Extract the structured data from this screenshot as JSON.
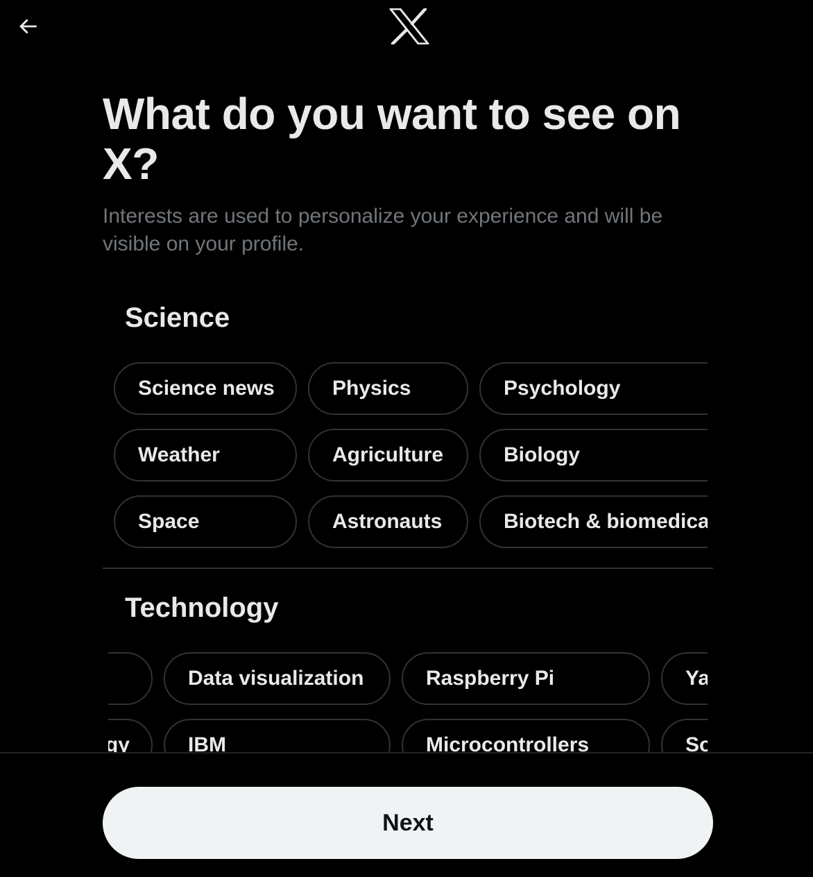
{
  "header": {
    "back_icon": "arrow-left-icon",
    "logo_icon": "x-logo-icon"
  },
  "title": "What do you want to see on X?",
  "subtitle": "Interests are used to personalize your experience and will be visible on your profile.",
  "sections": [
    {
      "heading": "Science",
      "chips": [
        [
          "Science news",
          "Physics",
          "Psychology"
        ],
        [
          "Weather",
          "Agriculture",
          "Biology"
        ],
        [
          "Space",
          "Astronauts",
          "Biotech & biomedical"
        ]
      ]
    },
    {
      "heading": "Technology",
      "chips": [
        [
          "",
          "Data visualization",
          "Raspberry Pi",
          "Ya"
        ],
        [
          "gy",
          "IBM",
          "Microcontrollers",
          "So"
        ]
      ]
    }
  ],
  "footer": {
    "next_label": "Next"
  },
  "colors": {
    "background": "#000000",
    "text_primary": "#e7e9ea",
    "text_secondary": "#71767b",
    "border": "#2f3336",
    "button_bg": "#eff3f4",
    "button_text": "#0f1419"
  }
}
